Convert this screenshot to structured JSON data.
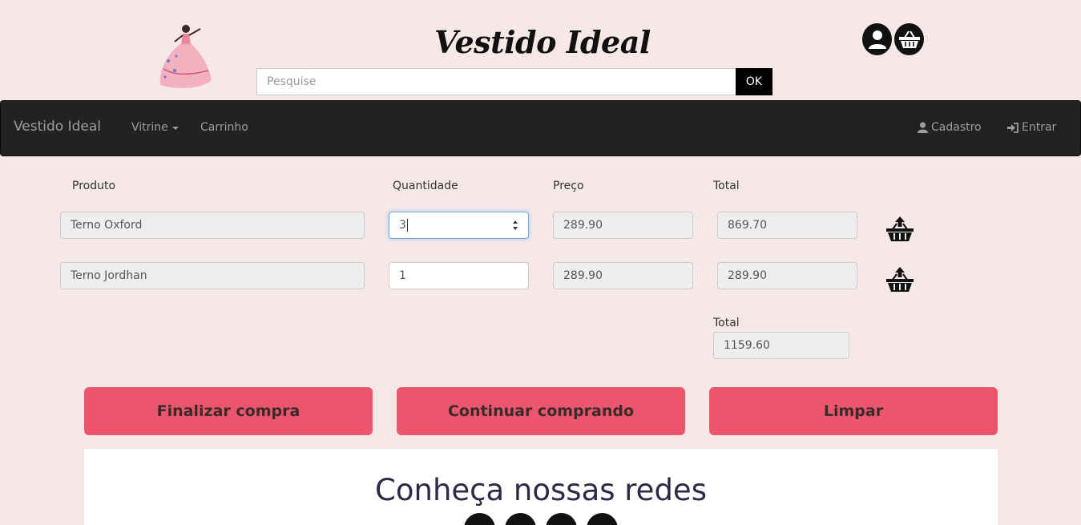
{
  "header": {
    "brand": "Vestido Ideal",
    "logo_icon": "dress-illustration",
    "search": {
      "placeholder": "Pesquise",
      "value": "",
      "button_label": "OK"
    },
    "icons": [
      "user-icon",
      "basket-icon"
    ]
  },
  "navbar": {
    "brand": "Vestido Ideal",
    "items": [
      {
        "label": "Vitrine",
        "dropdown": true
      },
      {
        "label": "Carrinho"
      }
    ],
    "right_items": [
      {
        "label": "Cadastro",
        "icon": "user-icon"
      },
      {
        "label": "Entrar",
        "icon": "sign-in-icon"
      }
    ]
  },
  "cart": {
    "headers": {
      "product": "Produto",
      "quantity": "Quantidade",
      "price": "Preço",
      "total": "Total"
    },
    "rows": [
      {
        "product": "Terno Oxford",
        "quantity": "3",
        "price": "289.90",
        "total": "869.70"
      },
      {
        "product": "Terno Jordhan",
        "quantity": "1",
        "price": "289.90",
        "total": "289.90"
      }
    ],
    "grand_total_label": "Total",
    "grand_total": "1159.60"
  },
  "actions": {
    "finalize": "Finalizar compra",
    "continue": "Continuar comprando",
    "clear": "Limpar"
  },
  "social": {
    "title": "Conheça nossas redes",
    "icons": [
      "facebook-icon",
      "instagram-icon",
      "youtube-icon",
      "pinterest-icon"
    ]
  },
  "colors": {
    "background": "#f7e8e8",
    "navbar": "#222222",
    "accent": "#ec566c"
  }
}
